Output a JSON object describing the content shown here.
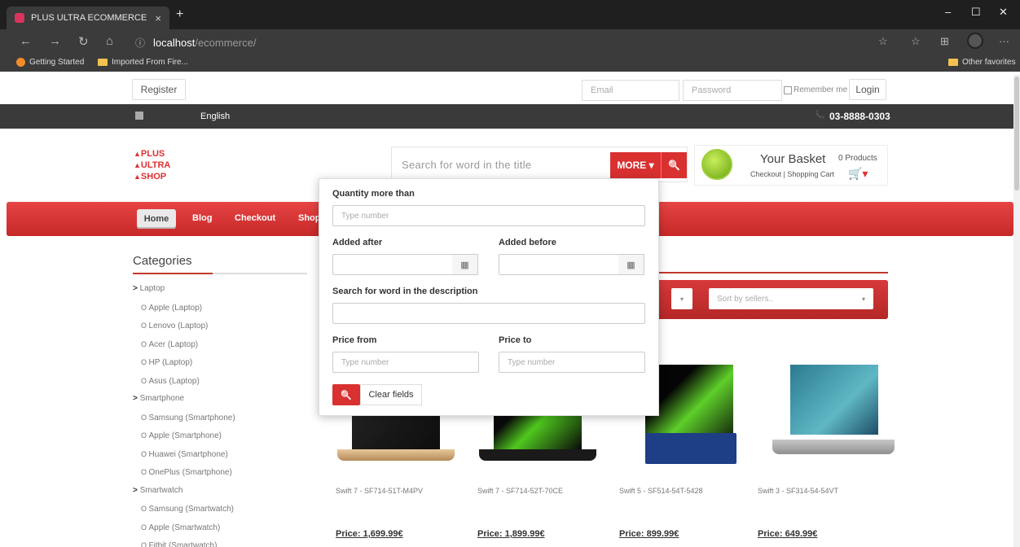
{
  "browser": {
    "tab_title": "PLUS ULTRA ECOMMERCE",
    "tab_close": "×",
    "new_tab": "+",
    "win_min": "–",
    "win_max": "☐",
    "win_close": "✕",
    "back": "←",
    "forward": "→",
    "refresh": "↻",
    "home": "⌂",
    "info": "ⓘ",
    "url_host": "localhost",
    "url_path": "/ecommerce/",
    "star": "☆",
    "favorites": "☆",
    "collections": "⊞",
    "menu": "···",
    "bookmarks": [
      "Getting Started",
      "Imported From Fire..."
    ],
    "other_favorites": "Other favorites"
  },
  "header": {
    "register": "Register",
    "email_placeholder": "Email",
    "password_placeholder": "Password",
    "remember_me": "Remember me",
    "login": "Login",
    "language": "English",
    "phone": "03-8888-0303",
    "phone_icon": "📞"
  },
  "logo": [
    "PLUS",
    "ULTRA",
    "SHOP"
  ],
  "search": {
    "placeholder": "Search for word in the title",
    "more_button": "MORE ▾",
    "search_icon": "🔍"
  },
  "basket": {
    "title": "Your Basket",
    "count": "0 Products",
    "links": "Checkout | Shopping Cart",
    "cart_icon": "🛒▾"
  },
  "nav": {
    "items": [
      "Home",
      "Blog",
      "Checkout",
      "Shop"
    ]
  },
  "categories": {
    "title": "Categories",
    "rows": [
      {
        "label": "Laptop",
        "type": "parent"
      },
      {
        "label": "Apple (Laptop)",
        "type": "child"
      },
      {
        "label": "Lenovo (Laptop)",
        "type": "child"
      },
      {
        "label": "Acer (Laptop)",
        "type": "child"
      },
      {
        "label": "HP (Laptop)",
        "type": "child"
      },
      {
        "label": "Asus (Laptop)",
        "type": "child"
      },
      {
        "label": "Smartphone",
        "type": "parent"
      },
      {
        "label": "Samsung (Smartphone)",
        "type": "child"
      },
      {
        "label": "Apple (Smartphone)",
        "type": "child"
      },
      {
        "label": "Huawei (Smartphone)",
        "type": "child"
      },
      {
        "label": "OnePlus (Smartphone)",
        "type": "child"
      },
      {
        "label": "Smartwatch",
        "type": "parent"
      },
      {
        "label": "Samsung (Smartwatch)",
        "type": "child"
      },
      {
        "label": "Apple (Smartwatch)",
        "type": "child"
      },
      {
        "label": "Fitbit (Smartwatch)",
        "type": "child"
      }
    ]
  },
  "sort": {
    "sellers_placeholder": "Sort by sellers..",
    "caret": "▾"
  },
  "products": [
    {
      "name": "Swift 7 - SF714-51T-M4PV",
      "price": "Price: 1,699.99€"
    },
    {
      "name": "Swift 7 - SF714-52T-70CE",
      "price": "Price: 1,899.99€"
    },
    {
      "name": "Swift 5 - SF514-54T-5428",
      "price": "Price: 899.99€"
    },
    {
      "name": "Swift 3 - SF314-54-54VT",
      "price": "Price: 649.99€"
    }
  ],
  "advanced": {
    "quantity_label": "Quantity more than",
    "quantity_placeholder": "Type number",
    "added_after_label": "Added after",
    "added_before_label": "Added before",
    "calendar_icon": "▦",
    "description_label": "Search for word in the description",
    "price_from_label": "Price from",
    "price_to_label": "Price to",
    "price_from_placeholder": "Type number",
    "price_to_placeholder": "Type number",
    "go_icon": "🔍",
    "clear_label": "Clear fields"
  },
  "colors": {
    "accent_red": "#d93030",
    "dark_bar": "#3a3a3a"
  }
}
